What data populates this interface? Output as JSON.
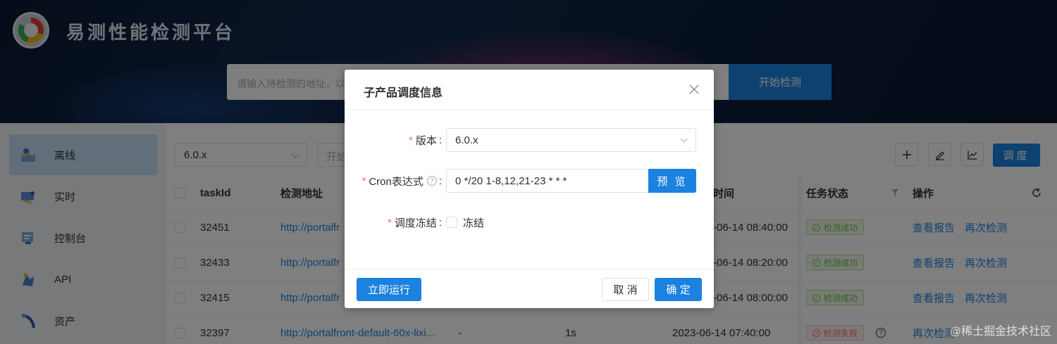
{
  "header": {
    "brand": "易测性能检测平台",
    "search_placeholder": "请输入待检测的地址，以",
    "search_button": "开始检测"
  },
  "sidebar": {
    "items": [
      {
        "label": "离线",
        "icon": "offline-icon",
        "active": true
      },
      {
        "label": "实时",
        "icon": "realtime-icon",
        "active": false
      },
      {
        "label": "控制台",
        "icon": "console-icon",
        "active": false
      },
      {
        "label": "API",
        "icon": "api-icon",
        "active": false
      },
      {
        "label": "资产",
        "icon": "asset-icon",
        "active": false
      }
    ]
  },
  "toolbar": {
    "version_value": "6.0.x",
    "date_placeholder": "开始",
    "schedule_button": "调度"
  },
  "table": {
    "headers": {
      "task_id": "taskId",
      "url": "检测地址",
      "time": "时间",
      "status": "任务状态",
      "actions": "操作"
    },
    "rows": [
      {
        "task_id": "32451",
        "url": "http://portalfr",
        "time": "-06-14 08:40:00",
        "status": "检测成功",
        "status_type": "ok",
        "actions": [
          "查看报告",
          "再次检测"
        ]
      },
      {
        "task_id": "32433",
        "url": "http://portalfr",
        "time": "-06-14 08:20:00",
        "status": "检测成功",
        "status_type": "ok",
        "actions": [
          "查看报告",
          "再次检测"
        ]
      },
      {
        "task_id": "32415",
        "url": "http://portalfr",
        "time": "-06-14 08:00:00",
        "status": "检测成功",
        "status_type": "ok",
        "actions": [
          "查看报告",
          "再次检测"
        ]
      },
      {
        "task_id": "32397",
        "url": "http://portalfront-default-60x-lixi...",
        "dash": "-",
        "duration": "1s",
        "time": "2023-06-14 07:40:00",
        "status": "检测失败",
        "status_type": "fail",
        "actions": [
          "再次检测"
        ]
      }
    ]
  },
  "dialog": {
    "title": "子产品调度信息",
    "version_label": "版本",
    "version_value": "6.0.x",
    "cron_label": "Cron表达式",
    "cron_value": "0 */20 1-8,12,21-23 * * *",
    "preview_button": "预 览",
    "freeze_label": "调度冻结",
    "freeze_checkbox_label": "冻结",
    "run_now_button": "立即运行",
    "cancel_button": "取 消",
    "confirm_button": "确 定"
  },
  "watermark": "@稀土掘金技术社区",
  "colors": {
    "primary": "#1b82e0",
    "success": "#67c23a",
    "danger": "#f56c6c"
  }
}
